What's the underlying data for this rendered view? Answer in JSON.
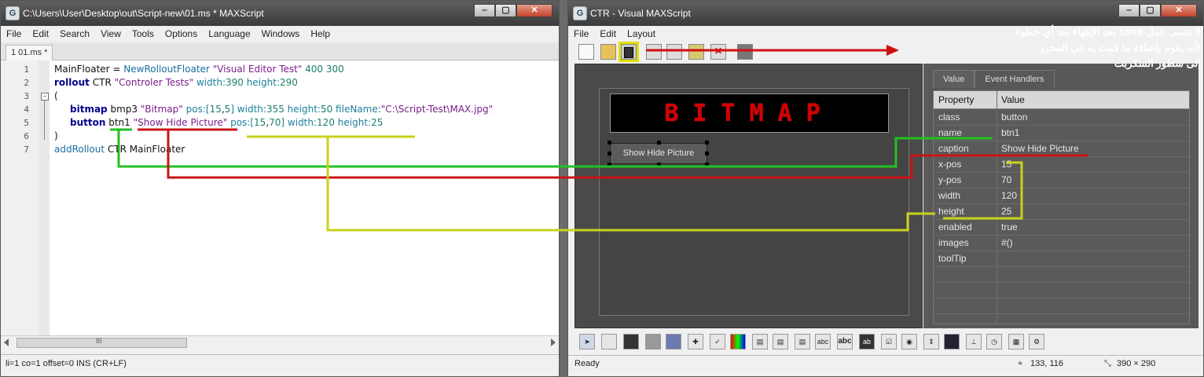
{
  "left_window": {
    "title": "C:\\Users\\User\\Desktop\\out\\Script-new\\01.ms * MAXScript",
    "app_icon": "maxscript-logo",
    "menu": [
      "File",
      "Edit",
      "Search",
      "View",
      "Tools",
      "Options",
      "Language",
      "Windows",
      "Help"
    ],
    "tab_label": "1 01.ms *",
    "line_numbers": [
      "1",
      "2",
      "3",
      "4",
      "5",
      "6",
      "7"
    ],
    "code": {
      "l1": {
        "a": "MainFloater = ",
        "b": "NewRolloutFloater",
        "c": " \"Visual Editor Test\"",
        "d": " 400 300"
      },
      "l2": {
        "a": "rollout",
        "b": " CTR ",
        "c": "\"Controler Tests\"",
        "d": " width:",
        "e": "390",
        "f": " height:",
        "g": "290"
      },
      "l3": {
        "a": "("
      },
      "l4": {
        "a": "bitmap",
        "b": " bmp3 ",
        "c": "\"Bitmap\"",
        "d": " pos:[",
        "e": "15",
        "f": ",",
        "g": "5",
        "h": "] width:",
        "i": "355",
        "j": " height:",
        "k": "50",
        "l": " fileName:",
        "m": "\"C:\\Script-Test\\MAX.jpg\""
      },
      "l5": {
        "a": "button",
        "b": " btn1 ",
        "c": "\"Show Hide Picture\"",
        "d": " pos:[",
        "e": "15",
        "f": ",",
        "g": "70",
        "h": "] width:",
        "i": "120",
        "j": " height:",
        "k": "25"
      },
      "l6": {
        "a": ")"
      },
      "l7": {
        "a": "addRollout",
        "b": " CTR MainFloater"
      }
    },
    "scroll_thumb_glyph": "III",
    "status": "li=1 co=1 offset=0 INS (CR+LF)"
  },
  "right_window": {
    "title": "CTR - Visual MAXScript",
    "menu": [
      "File",
      "Edit",
      "Layout"
    ],
    "bitmap_text": "BITMAP",
    "button_caption": "Show Hide Picture",
    "property_tabs": [
      "Value",
      "Event Handlers"
    ],
    "grid_headers": {
      "property": "Property",
      "value": "Value"
    },
    "properties": [
      {
        "k": "class",
        "v": "button"
      },
      {
        "k": "name",
        "v": "btn1"
      },
      {
        "k": "caption",
        "v": "Show Hide Picture"
      },
      {
        "k": "x-pos",
        "v": "15"
      },
      {
        "k": "y-pos",
        "v": "70"
      },
      {
        "k": "width",
        "v": "120"
      },
      {
        "k": "height",
        "v": "25"
      },
      {
        "k": "enabled",
        "v": "true"
      },
      {
        "k": "images",
        "v": "#()"
      },
      {
        "k": "toolTip",
        "v": ""
      }
    ],
    "palette_labels": {
      "abc1": "abc",
      "abc2": "abc"
    },
    "status_left": "Ready",
    "status_pos": "133, 116",
    "status_size": "390 × 290"
  },
  "annotation": {
    "line1_a": "لا تنسى عمل",
    "line1_b": "save",
    "line1_c": "بعد الإنتهاء بعد أي خطوة",
    "line2": "لأنه يقوم بإضافة ما قمت به في المحرر",
    "line3": "إلى سطور السكربت"
  },
  "colors": {
    "highlight_save": "#e0e000",
    "arrow_red": "#d01010",
    "link_green": "#22c022",
    "link_red": "#c81414",
    "link_yellow": "#c8d21a"
  }
}
